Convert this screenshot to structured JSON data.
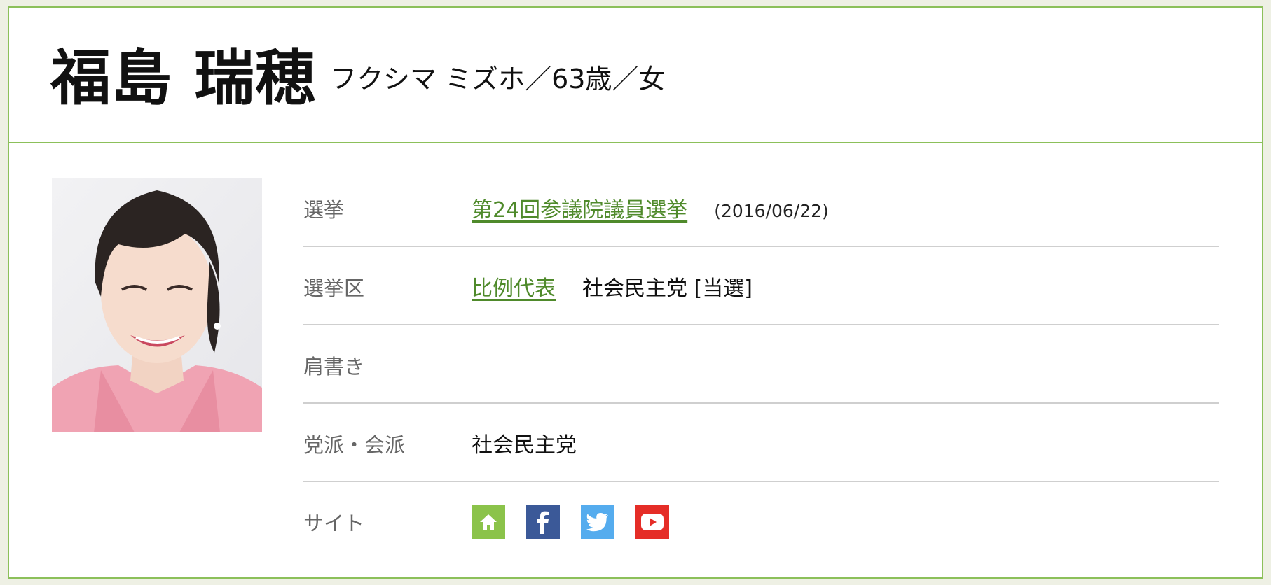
{
  "candidate": {
    "name": "福島 瑞穂",
    "reading_age_gender": "フクシマ ミズホ／63歳／女"
  },
  "rows": {
    "election": {
      "label": "選挙",
      "link": "第24回参議院議員選挙",
      "date": "(2016/06/22)"
    },
    "district": {
      "label": "選挙区",
      "link": "比例代表",
      "result": "社会民主党 [当選]"
    },
    "title": {
      "label": "肩書き",
      "value": ""
    },
    "party": {
      "label": "党派・会派",
      "value": "社会民主党"
    },
    "site": {
      "label": "サイト",
      "icons": [
        "home-icon",
        "facebook-icon",
        "twitter-icon",
        "youtube-icon"
      ]
    }
  },
  "colors": {
    "border": "#8cc05a",
    "link": "#4f8a2b",
    "home": "#8bc34a",
    "facebook": "#3b5998",
    "twitter": "#55acee",
    "youtube": "#e52d27"
  }
}
